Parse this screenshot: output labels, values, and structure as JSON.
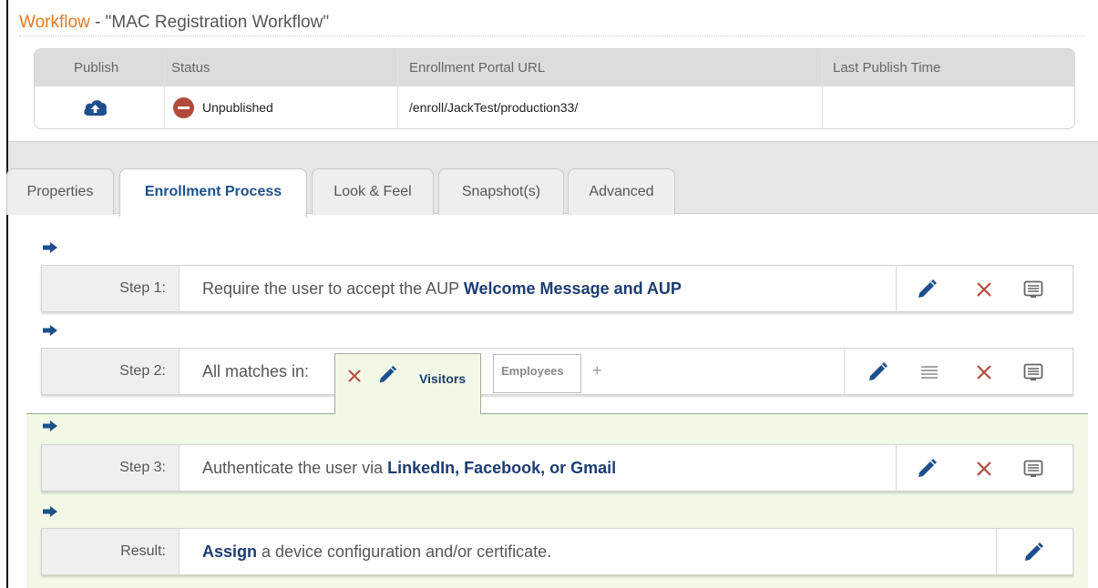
{
  "title": {
    "prefix": "Workflow",
    "separator": " - ",
    "name": "\"MAC Registration Workflow\""
  },
  "publish_table": {
    "headers": [
      "Publish",
      "Status",
      "Enrollment Portal URL",
      "Last Publish Time"
    ],
    "row": {
      "status": "Unpublished",
      "url": "/enroll/JackTest/production33/",
      "last_publish_time": ""
    }
  },
  "tabs": [
    {
      "label": "Properties",
      "active": false
    },
    {
      "label": "Enrollment Process",
      "active": true
    },
    {
      "label": "Look & Feel",
      "active": false
    },
    {
      "label": "Snapshot(s)",
      "active": false
    },
    {
      "label": "Advanced",
      "active": false
    }
  ],
  "steps": [
    {
      "label": "Step 1:",
      "text": "Require the user to accept the AUP ",
      "bold": "Welcome Message and AUP"
    },
    {
      "label": "Step 2:",
      "text": "All matches in:",
      "rule_tabs": [
        "Visitors",
        "Employees"
      ],
      "add": "+"
    },
    {
      "label": "Step 3:",
      "text": "Authenticate the user via ",
      "bold": "LinkedIn, Facebook, or Gmail"
    },
    {
      "label": "Result:",
      "bold": "Assign",
      "text": " a device configuration and/or certificate."
    }
  ],
  "colors": {
    "accent_orange": "#e07b20",
    "brand_blue": "#1d4f8c",
    "delete_red": "#b54a3c",
    "highlight_green": "#f1f8e5"
  },
  "icons": [
    "cloud-upload-icon",
    "minus-circle-icon",
    "arrow-right-icon",
    "pencil-icon",
    "close-icon",
    "note-icon",
    "reorder-icon"
  ]
}
